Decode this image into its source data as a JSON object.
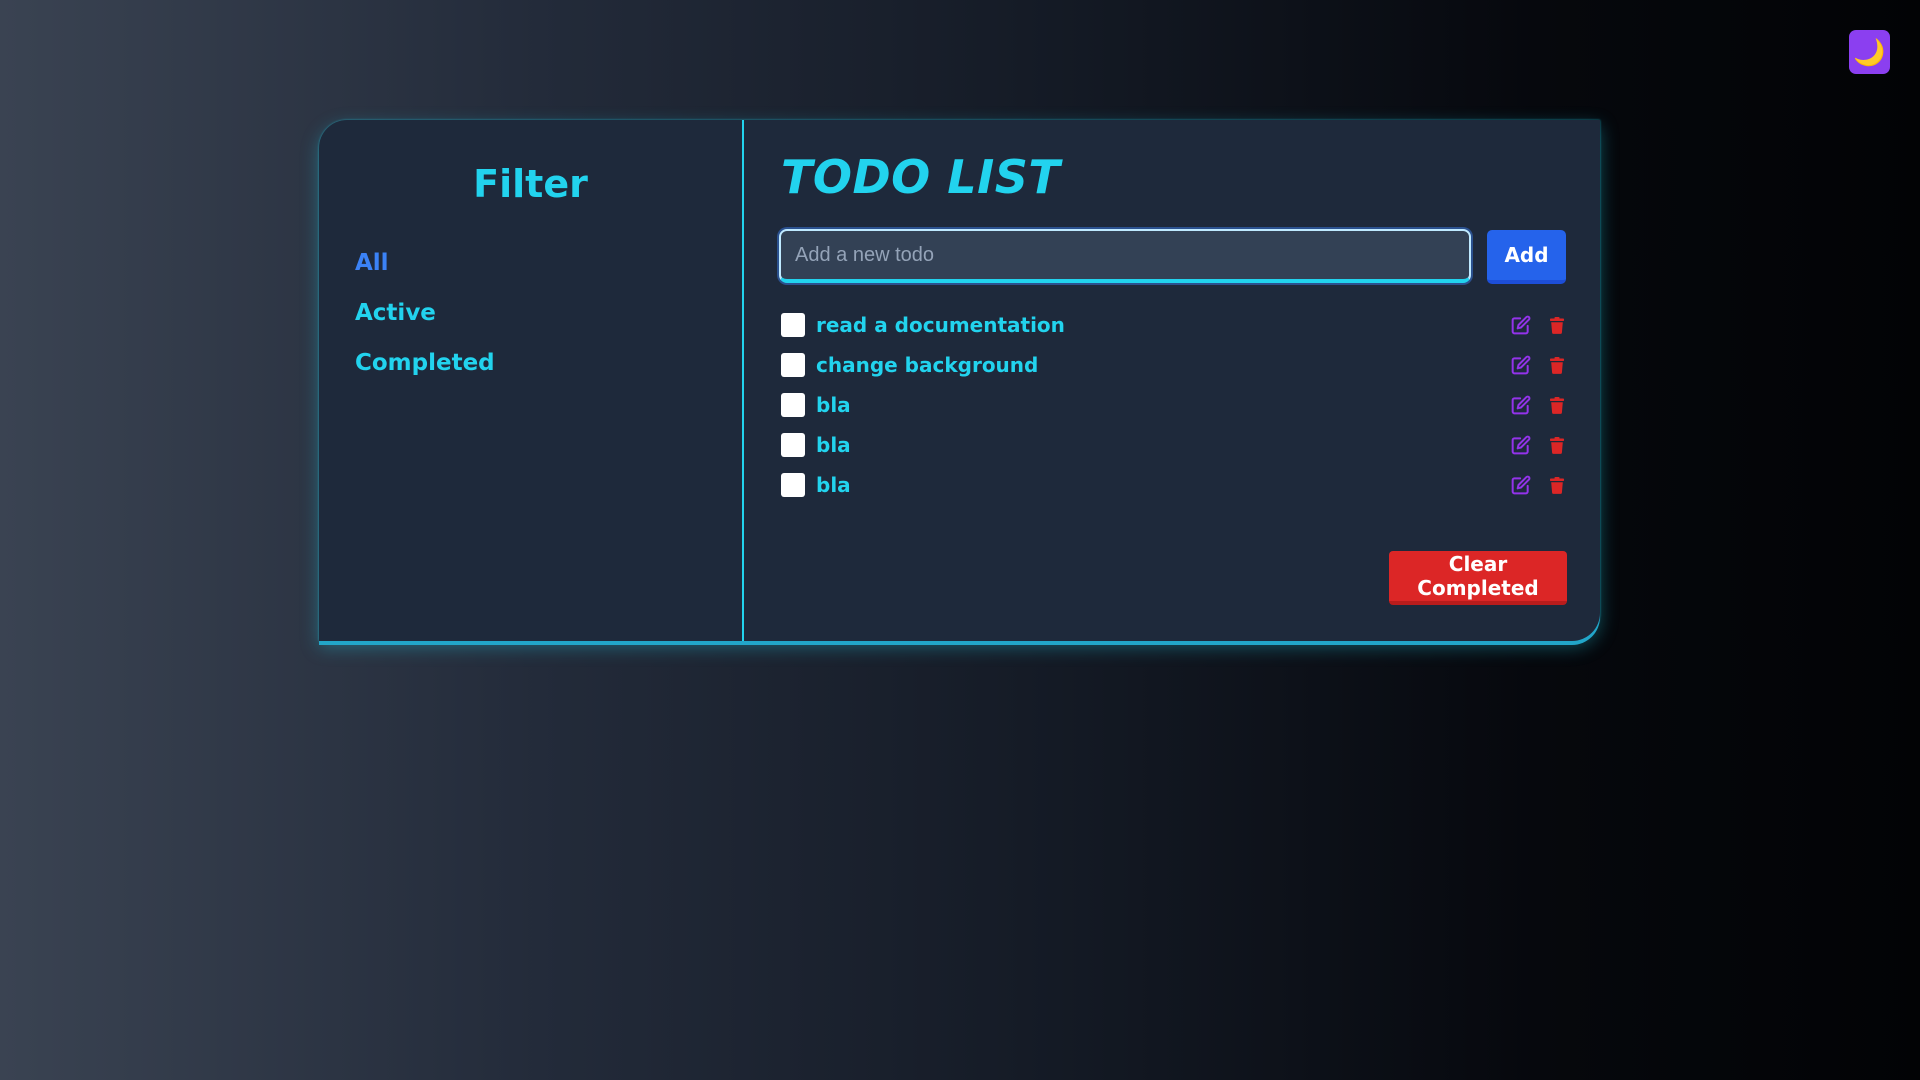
{
  "theme_toggle": {
    "icon": "moon-icon",
    "glyph": "🌙"
  },
  "sidebar": {
    "title": "Filter",
    "filters": [
      {
        "label": "All",
        "active": true
      },
      {
        "label": "Active",
        "active": false
      },
      {
        "label": "Completed",
        "active": false
      }
    ]
  },
  "main": {
    "title": "TODO LIST",
    "input": {
      "placeholder": "Add a new todo",
      "value": ""
    },
    "add_label": "Add",
    "todos": [
      {
        "text": "read a documentation",
        "completed": false
      },
      {
        "text": "change background",
        "completed": false
      },
      {
        "text": "bla",
        "completed": false
      },
      {
        "text": "bla",
        "completed": false
      },
      {
        "text": "bla",
        "completed": false
      }
    ],
    "clear_label": "Clear Completed"
  },
  "colors": {
    "accent": "#22d3ee",
    "active_filter": "#3b82f6",
    "edit_icon": "#9333ea",
    "delete_icon": "#dc2626",
    "add_button": "#2563eb",
    "clear_button": "#dc2626",
    "theme_toggle": "#8b3ff0"
  }
}
